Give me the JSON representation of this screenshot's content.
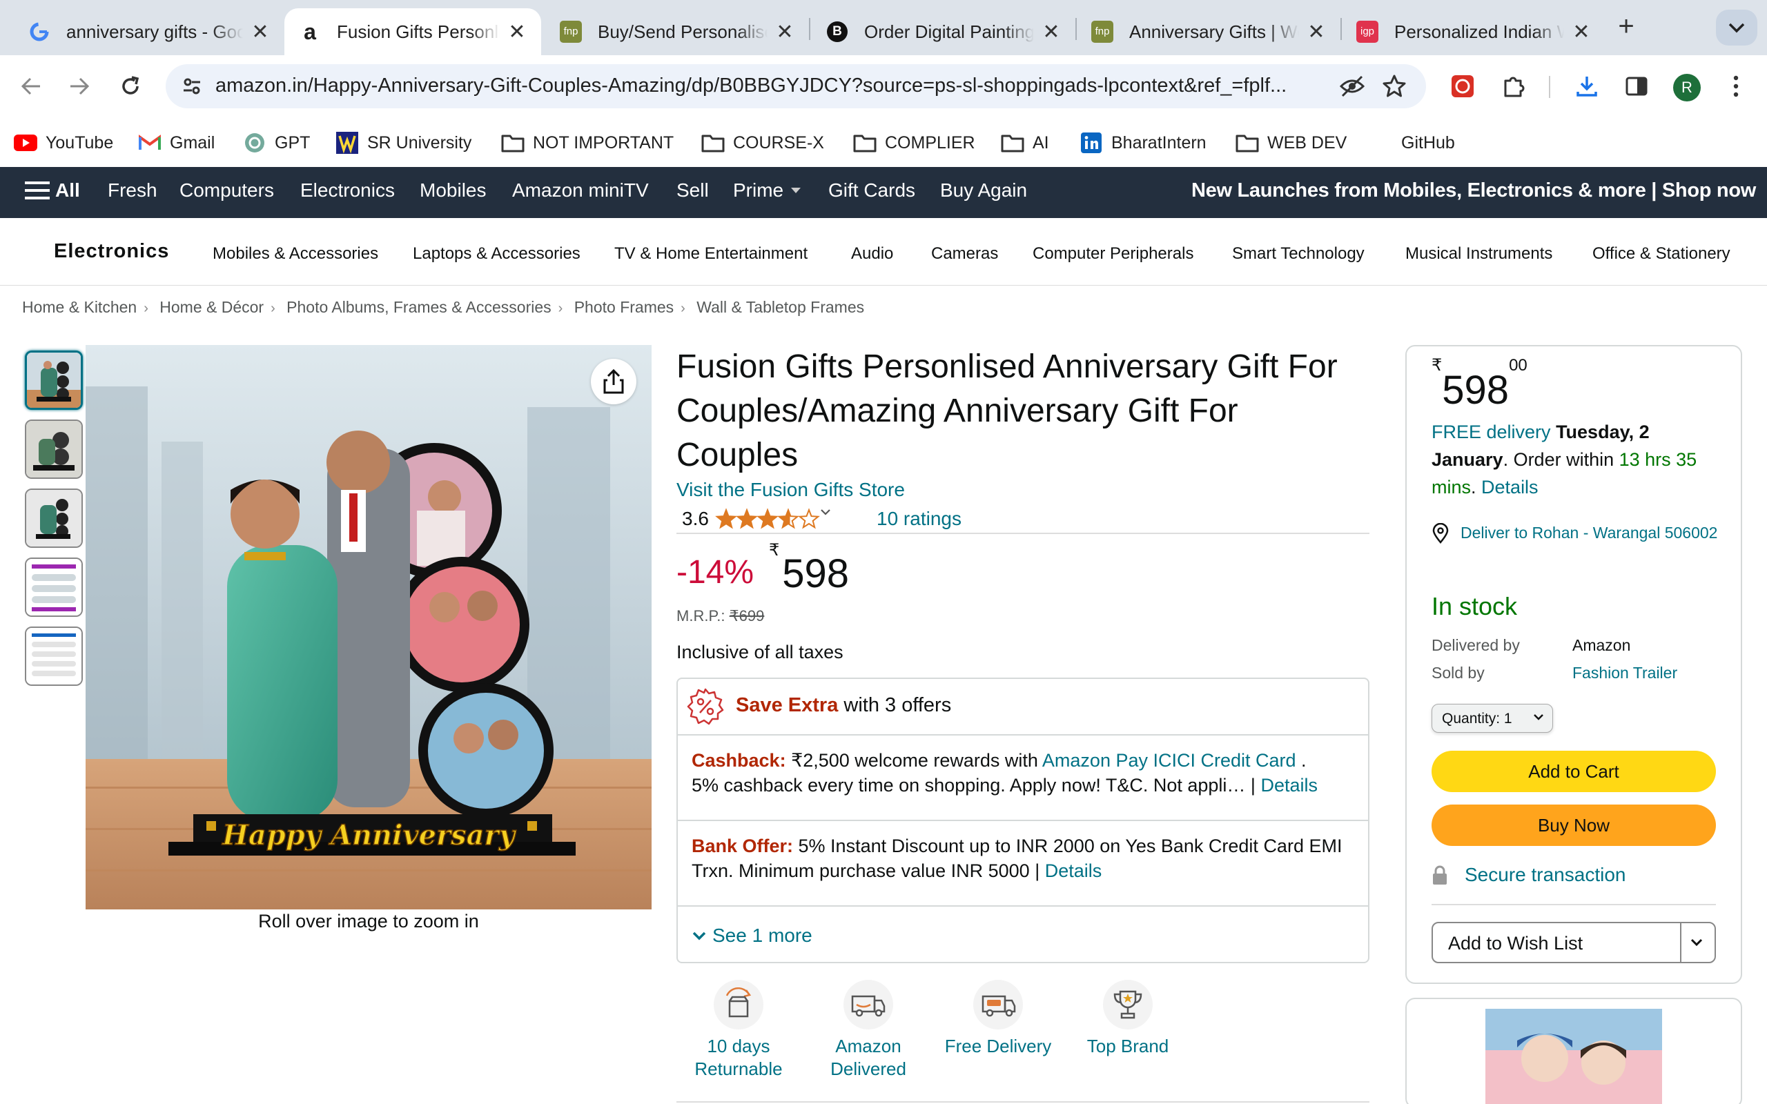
{
  "browser": {
    "tabs": [
      {
        "title": "anniversary gifts - Google Search",
        "icon": "google-icon"
      },
      {
        "title": "Fusion Gifts Personlised Anniversary Gift",
        "icon": "amazon-icon",
        "active": true
      },
      {
        "title": "Buy/Send Personalised Gifts Online",
        "icon": "fnp-icon"
      },
      {
        "title": "Order Digital Painting Online",
        "icon": "b-icon"
      },
      {
        "title": "Anniversary Gifts | Wedding Anniversary",
        "icon": "fnp-icon"
      },
      {
        "title": "Personalized Indian Wedding Gifts",
        "icon": "igp-icon"
      }
    ],
    "url": "amazon.in/Happy-Anniversary-Gift-Couples-Amazing/dp/B0BBGYJDCY?source=ps-sl-shoppingads-lpcontext&ref_=fplf...",
    "avatar_letter": "R",
    "bookmarks": [
      "YouTube",
      "Gmail",
      "GPT",
      "SR University",
      "NOT IMPORTANT",
      "COURSE-X",
      "COMPLIER",
      "AI",
      "BharatIntern",
      "WEB DEV",
      "GitHub"
    ],
    "fnp_badge": "fnp",
    "igp_badge": "igp"
  },
  "amazon_nav": {
    "all": "All",
    "items": [
      "Fresh",
      "Computers",
      "Electronics",
      "Mobiles",
      "Amazon miniTV",
      "Sell",
      "Prime",
      "Gift Cards",
      "Buy Again"
    ],
    "promo": "New Launches from Mobiles, Electronics & more | Shop now"
  },
  "subnav": {
    "brand": "Electronics",
    "items": [
      "Mobiles & Accessories",
      "Laptops & Accessories",
      "TV & Home Entertainment",
      "Audio",
      "Cameras",
      "Computer Peripherals",
      "Smart Technology",
      "Musical Instruments",
      "Office & Stationery"
    ]
  },
  "breadcrumb": [
    "Home & Kitchen",
    "Home & Décor",
    "Photo Albums, Frames & Accessories",
    "Photo Frames",
    "Wall & Tabletop Frames"
  ],
  "breadcrumb_sep": "›",
  "product": {
    "title": "Fusion Gifts Personlised Anniversary Gift For Couples/Amazing Anniversary Gift For Couples",
    "store_link": "Visit the Fusion Gifts Store",
    "rating": "3.6",
    "rating_value": 3.6,
    "rating_count": "10 ratings",
    "discount": "-14%",
    "currency": "₹",
    "price": "598",
    "mrp_label": "M.R.P.:",
    "mrp": "₹699",
    "taxes": "Inclusive of all taxes",
    "image_caption": "Roll over image to zoom in",
    "image_banner": "Happy Anniversary",
    "thumbnail_count": 5
  },
  "offers": {
    "header_bold": "Save Extra",
    "header_rest": " with 3 offers",
    "cashback": {
      "label": "Cashback:",
      "text1": " ₹2,500 welcome rewards with ",
      "link": "Amazon Pay ICICI Credit Card",
      "text2": " .",
      "text3": "5% cashback every time on shopping. Apply now! T&C. Not appli…",
      "sep": " | ",
      "details": "Details"
    },
    "bank": {
      "label": "Bank Offer:",
      "text": " 5% Instant Discount up to INR 2000 on Yes Bank Credit Card EMI Trxn. Minimum purchase value INR 5000 ",
      "sep": " | ",
      "details": "Details"
    },
    "see_more": "See 1 more"
  },
  "badges": [
    {
      "line1": "10 days",
      "line2": "Returnable",
      "icon": "return-box-icon"
    },
    {
      "line1": "Amazon",
      "line2": "Delivered",
      "icon": "delivery-truck-icon"
    },
    {
      "line1": "Free Delivery",
      "line2": "",
      "icon": "free-delivery-icon"
    },
    {
      "line1": "Top Brand",
      "line2": "",
      "icon": "trophy-icon"
    }
  ],
  "buybox": {
    "currency": "₹",
    "price_whole": "598",
    "price_fraction": "00",
    "free_delivery": "FREE delivery",
    "delivery_date": "Tuesday, 2 January",
    "order_within_pre": ". Order within ",
    "countdown": "13 hrs 35 mins",
    "dot": ". ",
    "details": "Details",
    "deliver_to": "Deliver to Rohan - Warangal 506002",
    "stock": "In stock",
    "delivered_by_label": "Delivered by",
    "delivered_by": "Amazon",
    "sold_by_label": "Sold by",
    "sold_by": "Fashion Trailer",
    "quantity_label": "Quantity:",
    "quantity": "1",
    "add_to_cart": "Add to Cart",
    "buy_now": "Buy Now",
    "secure": "Secure transaction",
    "wishlist": "Add to Wish List"
  },
  "colors": {
    "nav_bg": "#232f3e",
    "link": "#007185",
    "deal_red": "#cc0c39",
    "offer_label": "#b12704",
    "in_stock": "#007600",
    "cart_button": "#ffd814",
    "buy_button": "#ffa41c",
    "star": "#de7921"
  }
}
